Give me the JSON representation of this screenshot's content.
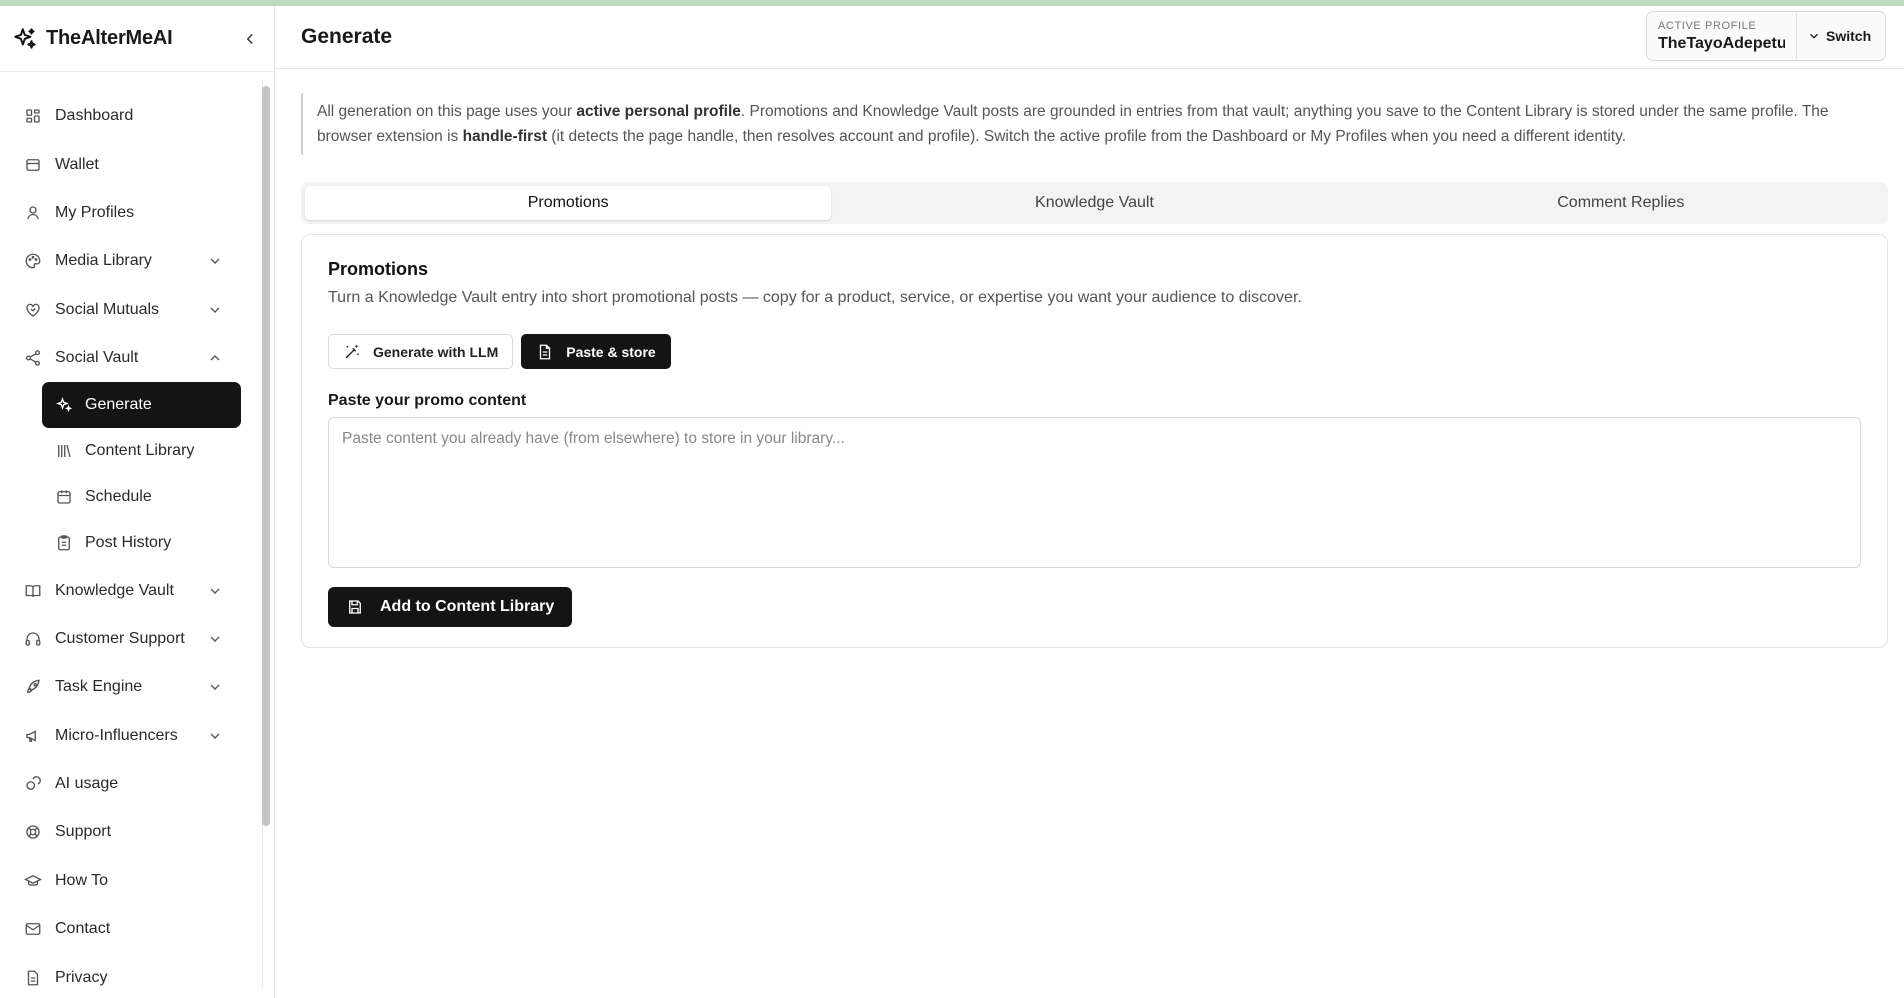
{
  "app": {
    "name": "TheAlterMeAI",
    "accent_bar_color": "#bcdcbf"
  },
  "sidebar": {
    "items": [
      {
        "label": "Dashboard",
        "icon": "grid-icon"
      },
      {
        "label": "Wallet",
        "icon": "wallet-icon"
      },
      {
        "label": "My Profiles",
        "icon": "user-icon"
      },
      {
        "label": "Media Library",
        "icon": "palette-icon",
        "chevron": "down"
      },
      {
        "label": "Social Mutuals",
        "icon": "heart-handshake-icon",
        "chevron": "down"
      },
      {
        "label": "Social Vault",
        "icon": "share-icon",
        "chevron": "up"
      }
    ],
    "social_vault_sub": [
      {
        "label": "Generate",
        "icon": "sparkles-icon",
        "active": true
      },
      {
        "label": "Content Library",
        "icon": "library-icon"
      },
      {
        "label": "Schedule",
        "icon": "calendar-icon"
      },
      {
        "label": "Post History",
        "icon": "clipboard-icon"
      }
    ],
    "items_after": [
      {
        "label": "Knowledge Vault",
        "icon": "book-icon",
        "chevron": "down"
      },
      {
        "label": "Customer Support",
        "icon": "headset-icon",
        "chevron": "down"
      },
      {
        "label": "Task Engine",
        "icon": "rocket-icon",
        "chevron": "down"
      },
      {
        "label": "Micro-Influencers",
        "icon": "megaphone-icon",
        "chevron": "down"
      },
      {
        "label": "AI usage",
        "icon": "coins-icon"
      },
      {
        "label": "Support",
        "icon": "lifebuoy-icon"
      },
      {
        "label": "How To",
        "icon": "graduation-cap-icon"
      },
      {
        "label": "Contact",
        "icon": "mail-icon"
      },
      {
        "label": "Privacy",
        "icon": "file-icon"
      }
    ]
  },
  "header": {
    "title": "Generate",
    "active_profile_label": "ACTIVE PROFILE",
    "active_profile_value": "TheTayoAdepetu",
    "switch_label": "Switch"
  },
  "notice": {
    "p1": "All generation on this page uses your ",
    "b1": "active personal profile",
    "p2": ". Promotions and Knowledge Vault posts are grounded in entries from that vault; anything you save to the Content Library is stored under the same profile. The browser extension is ",
    "b2": "handle-first",
    "p3": " (it detects the page handle, then resolves account and profile). Switch the active profile from the Dashboard or My Profiles when you need a different identity."
  },
  "tabs": [
    {
      "label": "Promotions",
      "active": true
    },
    {
      "label": "Knowledge Vault",
      "active": false
    },
    {
      "label": "Comment Replies",
      "active": false
    }
  ],
  "card": {
    "title": "Promotions",
    "description": "Turn a Knowledge Vault entry into short promotional posts — copy for a product, service, or expertise you want your audience to discover.",
    "mode_generate": "Generate with LLM",
    "mode_paste": "Paste & store",
    "field_label": "Paste your promo content",
    "textarea_placeholder": "Paste content you already have (from elsewhere) to store in your library...",
    "textarea_value": "",
    "add_button": "Add to Content Library"
  }
}
